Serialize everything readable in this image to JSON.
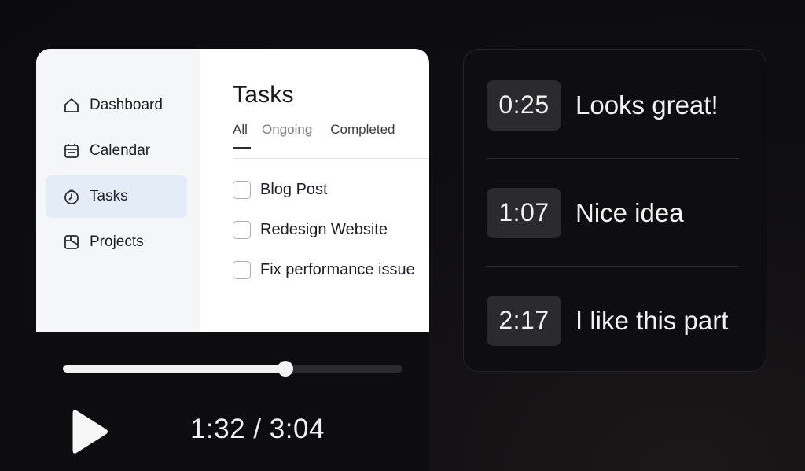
{
  "app": {
    "sidebar": {
      "items": [
        {
          "label": "Dashboard",
          "icon": "home-icon"
        },
        {
          "label": "Calendar",
          "icon": "calendar-icon"
        },
        {
          "label": "Tasks",
          "icon": "clock-icon",
          "active": true
        },
        {
          "label": "Projects",
          "icon": "folder-icon"
        }
      ]
    },
    "main": {
      "title": "Tasks",
      "tabs": [
        {
          "label": "All",
          "active": true
        },
        {
          "label": "Ongoing"
        },
        {
          "label": "Completed"
        }
      ],
      "tasks": [
        {
          "label": "Blog Post",
          "checked": false
        },
        {
          "label": "Redesign Website",
          "checked": false
        },
        {
          "label": "Fix performance issue",
          "checked": false
        }
      ]
    }
  },
  "player": {
    "time_display": "1:32 / 3:04",
    "progress_fraction": 0.656,
    "play_icon": "play-icon"
  },
  "comments": [
    {
      "timestamp": "0:25",
      "text": "Looks great!"
    },
    {
      "timestamp": "1:07",
      "text": "Nice idea"
    },
    {
      "timestamp": "2:17",
      "text": "I like this part"
    }
  ],
  "colors": {
    "background": "#0b0b0f",
    "sidebar_active": "#e4ecf7",
    "timestamp_badge": "#2a2a2f",
    "progress_fill": "#f2f2f2"
  }
}
